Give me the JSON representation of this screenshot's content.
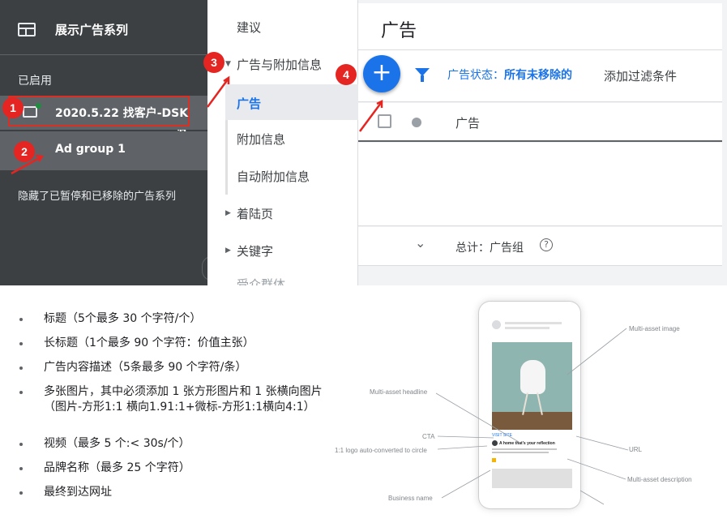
{
  "campaign_panel": {
    "title": "展示广告系列",
    "enabled_label": "已启用",
    "sort_icon": "sort-arrows-icon",
    "campaign_name": "2020.5.22 找客户-DSK",
    "ad_group_name": "Ad group 1",
    "hidden_note": "隐藏了已暂停和已移除的广告系列",
    "collapse_icon": "‹"
  },
  "nav_menu": {
    "items": [
      {
        "label": "建议"
      },
      {
        "label": "广告与附加信息"
      },
      {
        "label": "广告"
      },
      {
        "label": "附加信息"
      },
      {
        "label": "自动附加信息"
      },
      {
        "label": "着陆页"
      },
      {
        "label": "关键字"
      },
      {
        "label": "受众群体"
      }
    ]
  },
  "main": {
    "title": "广告",
    "add_icon": "+",
    "filter_status_label": "广告状态：",
    "filter_status_value": "所有未移除的",
    "add_filter": "添加过滤条件",
    "column_ad": "广告",
    "total_label": "总计：广告组",
    "help_icon": "?"
  },
  "annotations": {
    "badge_1": "1",
    "badge_2": "2",
    "badge_3": "3",
    "badge_4": "4",
    "accent": "#e52521"
  },
  "requirements": [
    "标题（5个最多 30 个字符/个）",
    "长标题（1个最多 90 个字符：价值主张）",
    "广告内容描述（5条最多 90 个字符/条）",
    "多张图片，其中必须添加 1 张方形图片和 1 张横向图片（图片-方形1:1 横向1.91:1+微标-方形1:1横向4:1）",
    "视频（最多 5 个:< 30s/个）",
    "品牌名称（最多 25 个字符）",
    "最终到达网址"
  ],
  "phone_mock": {
    "visit_cta": "VISIT SITE",
    "headline": "A home that's your reflection",
    "labels": {
      "multi_asset_image": "Multi-asset image",
      "multi_asset_headline": "Multi-asset headline",
      "cta": "CTA",
      "logo": "1:1 logo auto-converted to circle",
      "url": "URL",
      "multi_asset_description": "Multi-asset description",
      "business_name": "Business name"
    }
  },
  "colors": {
    "sidebar_bg": "#3c4043",
    "selected_bg": "#5f6368",
    "brand_blue": "#1a73e8"
  }
}
